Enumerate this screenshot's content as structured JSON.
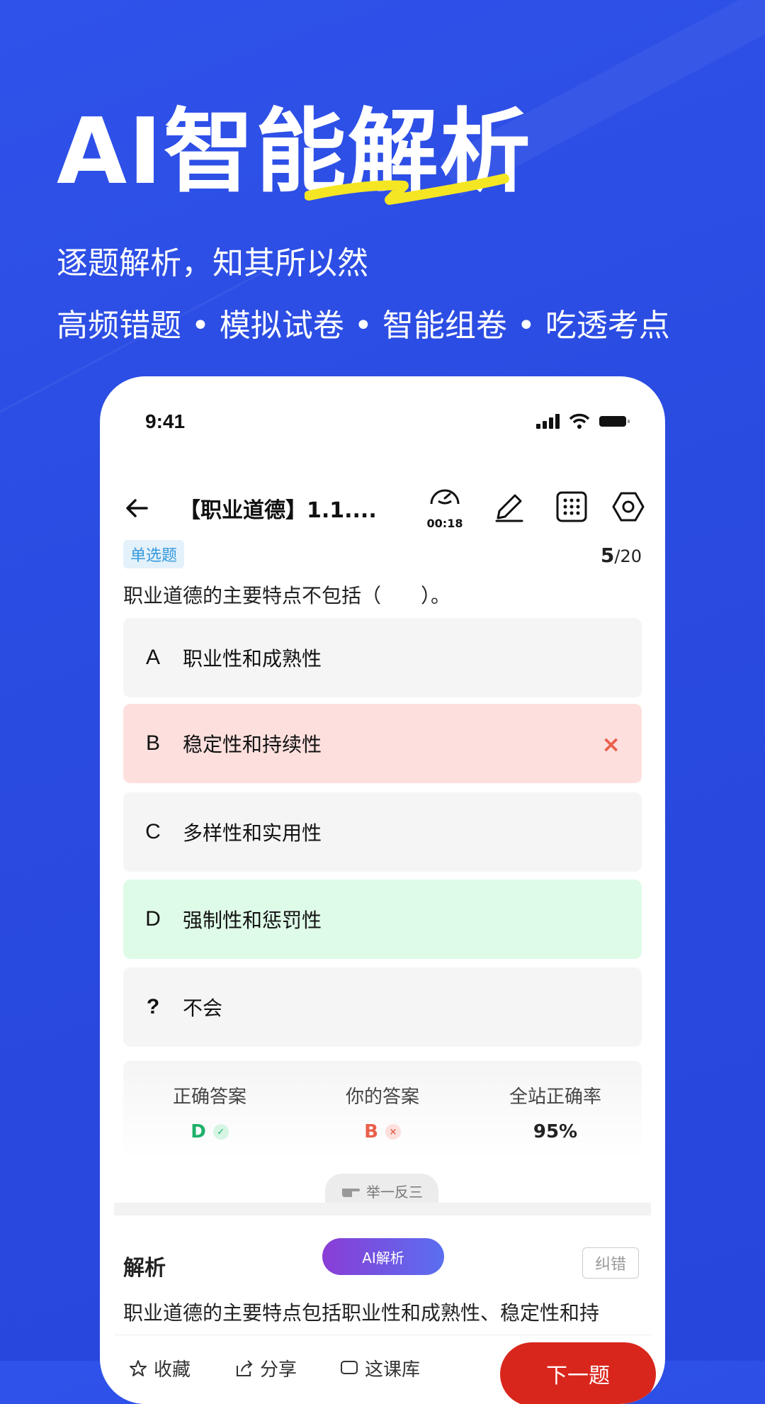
{
  "hero": {
    "title": "AI智能解析",
    "subtitle1": "逐题解析，知其所以然",
    "subtitle2": "高频错题 • 模拟试卷 • 智能组卷 • 吃透考点",
    "accent_color": "#f5e623"
  },
  "status_bar": {
    "time": "9:41"
  },
  "nav": {
    "title": "【职业道德】1.1....",
    "timer": "00:18",
    "icons": [
      "arrow-left-icon",
      "timer-icon",
      "pencil-icon",
      "grid-icon",
      "settings-hex-icon"
    ]
  },
  "question": {
    "type": "单选题",
    "current": "5",
    "total": "/20",
    "text": "职业道德的主要特点不包括（　　）。",
    "options": [
      {
        "letter": "A",
        "text": "职业性和成熟性",
        "state": "normal"
      },
      {
        "letter": "B",
        "text": "稳定性和持续性",
        "state": "wrong"
      },
      {
        "letter": "C",
        "text": "多样性和实用性",
        "state": "normal"
      },
      {
        "letter": "D",
        "text": "强制性和惩罚性",
        "state": "correct"
      },
      {
        "letter": "?",
        "text": "不会",
        "state": "normal"
      }
    ],
    "wrong_mark": "×"
  },
  "stats": {
    "correct_label": "正确答案",
    "correct_value": "D",
    "yours_label": "你的答案",
    "yours_value": "B",
    "rate_label": "全站正确率",
    "rate_value": "95%",
    "check_mark": "✓",
    "cross_mark": "×"
  },
  "hint": {
    "label": "举一反三"
  },
  "analysis": {
    "title": "解析",
    "ai_button": "AI解析",
    "correct_button": "纠错",
    "text": "职业道德的主要特点包括职业性和成熟性、稳定性和持"
  },
  "bottom_bar": {
    "favorite": "收藏",
    "share": "分享",
    "class": "这课库",
    "next": "下一题"
  },
  "colors": {
    "background": "#2a4be0",
    "wrong_bg": "#fde0de",
    "correct_bg": "#defbe7",
    "correct_text": "#1eb06a",
    "wrong_text": "#e8604c",
    "next_button": "#d9261c"
  }
}
